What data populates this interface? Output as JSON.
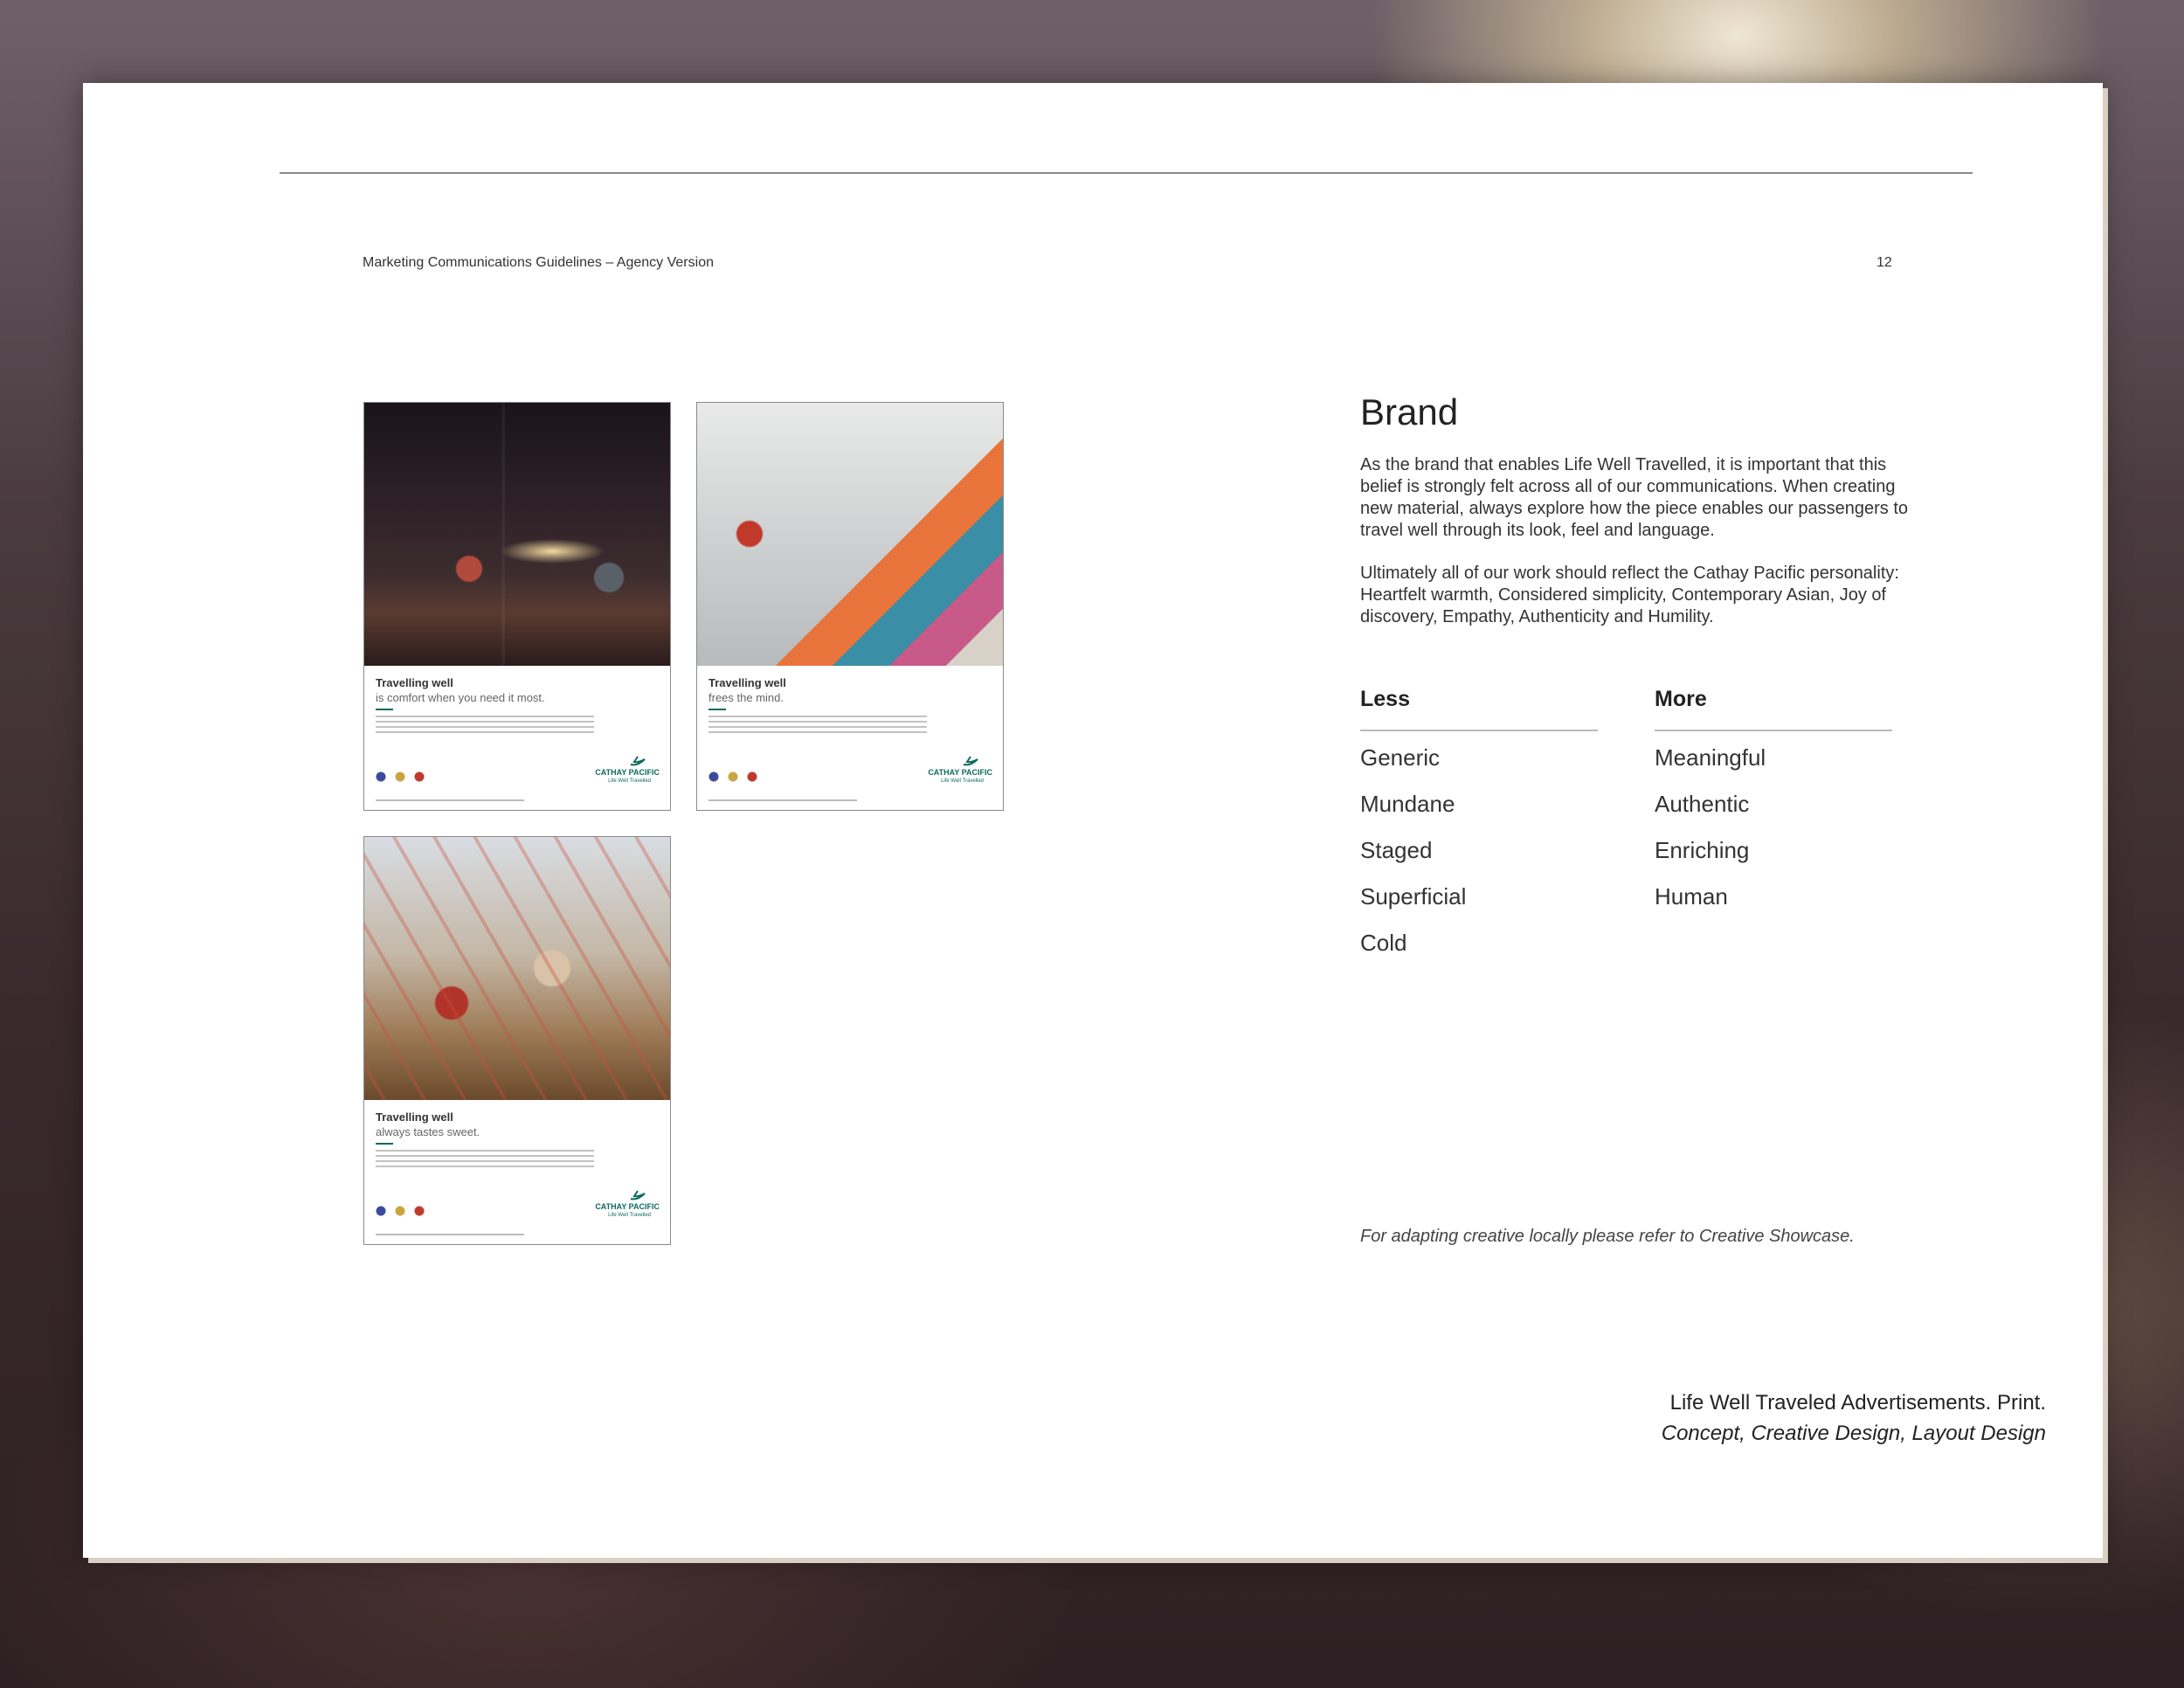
{
  "header": {
    "doc_title": "Marketing Communications Guidelines – Agency Version",
    "page_number": "12"
  },
  "ads": [
    {
      "headline": "Travelling well",
      "subline": "is comfort when you need it most.",
      "brand": "CATHAY PACIFIC",
      "tagline": "Life Well Travelled"
    },
    {
      "headline": "Travelling well",
      "subline": "frees the mind.",
      "brand": "CATHAY PACIFIC",
      "tagline": "Life Well Travelled"
    },
    {
      "headline": "Travelling well",
      "subline": "always tastes sweet.",
      "brand": "CATHAY PACIFIC",
      "tagline": "Life Well Travelled"
    }
  ],
  "brand": {
    "heading": "Brand",
    "paragraph1": "As the brand that enables Life Well Travelled, it is important that this belief is strongly felt across all of our communications. When creating new material, always explore how the piece enables our passengers to travel well through its look, feel and language.",
    "paragraph2": "Ultimately all of our work should reflect the Cathay Pacific personality: Heartfelt warmth, Considered simplicity, Contemporary Asian, Joy of discovery, Empathy, Authenticity and Humility.",
    "less_heading": "Less",
    "more_heading": "More",
    "less_items": [
      "Generic",
      "Mundane",
      "Staged",
      "Superficial",
      "Cold"
    ],
    "more_items": [
      "Meaningful",
      "Authentic",
      "Enriching",
      "Human"
    ],
    "note": "For adapting creative locally please refer to Creative Showcase."
  },
  "caption": {
    "line1": "Life Well Traveled Advertisements. Print.",
    "line2": "Concept, Creative Design, Layout Design"
  },
  "colors": {
    "accent": "#0b6b5d"
  }
}
